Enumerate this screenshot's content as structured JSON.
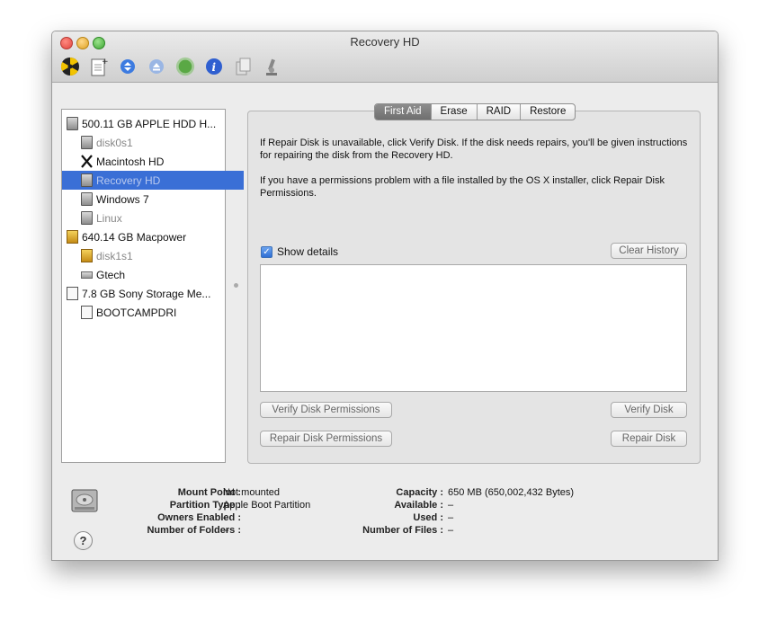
{
  "window": {
    "title": "Recovery HD"
  },
  "toolbar": {
    "icons": [
      "burn-icon",
      "new-image-icon",
      "mount-icon",
      "eject-icon",
      "enable-journaling-icon",
      "info-icon",
      "convert-icon",
      "log-icon"
    ]
  },
  "sidebar": {
    "items": [
      {
        "label": "500.11 GB APPLE HDD H...",
        "icon": "hdd",
        "level": 0,
        "dimmed": false,
        "selected": false
      },
      {
        "label": "disk0s1",
        "icon": "hdd",
        "level": 1,
        "dimmed": true,
        "selected": false
      },
      {
        "label": "Macintosh HD",
        "icon": "osx",
        "level": 1,
        "dimmed": false,
        "selected": false
      },
      {
        "label": "Recovery HD",
        "icon": "hdd",
        "level": 1,
        "dimmed": true,
        "selected": true
      },
      {
        "label": "Windows 7",
        "icon": "hdd",
        "level": 1,
        "dimmed": false,
        "selected": false
      },
      {
        "label": "Linux",
        "icon": "hdd",
        "level": 1,
        "dimmed": true,
        "selected": false
      },
      {
        "label": "640.14 GB Macpower",
        "icon": "external",
        "level": 0,
        "dimmed": false,
        "selected": false
      },
      {
        "label": "disk1s1",
        "icon": "external",
        "level": 1,
        "dimmed": true,
        "selected": false
      },
      {
        "label": "Gtech",
        "icon": "network",
        "level": 1,
        "dimmed": false,
        "selected": false
      },
      {
        "label": "7.8 GB Sony Storage Me...",
        "icon": "usb",
        "level": 0,
        "dimmed": false,
        "selected": false
      },
      {
        "label": "BOOTCAMPDRI",
        "icon": "usb",
        "level": 1,
        "dimmed": false,
        "selected": false
      }
    ]
  },
  "tabs": [
    "First Aid",
    "Erase",
    "RAID",
    "Restore"
  ],
  "active_tab": "First Aid",
  "first_aid": {
    "info_1": "If Repair Disk is unavailable, click Verify Disk. If the disk needs repairs, you'll be given instructions for repairing the disk from the Recovery HD.",
    "info_2": "If you have a permissions problem with a file installed by the OS X installer, click Repair Disk Permissions.",
    "show_details_label": "Show details",
    "show_details_checked": true,
    "clear_history": "Clear History",
    "verify_permissions": "Verify Disk Permissions",
    "verify_disk": "Verify Disk",
    "repair_permissions": "Repair Disk Permissions",
    "repair_disk": "Repair Disk"
  },
  "details": {
    "mount_point_label": "Mount Point :",
    "mount_point": "Not mounted",
    "partition_type_label": "Partition Type :",
    "partition_type": "Apple Boot Partition",
    "owners_enabled_label": "Owners Enabled :",
    "owners_enabled": "–",
    "num_folders_label": "Number of Folders :",
    "num_folders": "–",
    "capacity_label": "Capacity :",
    "capacity": "650 MB (650,002,432 Bytes)",
    "available_label": "Available :",
    "available": "–",
    "used_label": "Used :",
    "used": "–",
    "num_files_label": "Number of Files :",
    "num_files": "–"
  },
  "help_label": "?"
}
